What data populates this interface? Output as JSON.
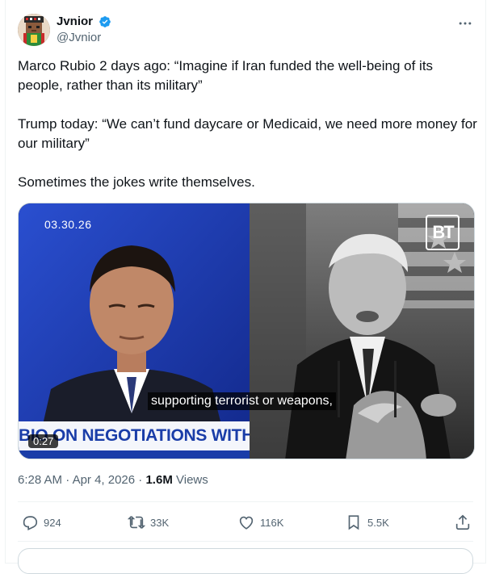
{
  "author": {
    "display_name": "Jvnior",
    "handle": "@Jvnior",
    "verified": true,
    "verified_color": "#1d9bf0"
  },
  "tweet": {
    "paragraphs": [
      "Marco Rubio 2 days ago: “Imagine if Iran funded the well-being of its people, rather than its military”",
      "Trump today: “We can’t fund daycare or Medicaid, we need more money for our military”",
      "Sometimes the jokes write themselves."
    ]
  },
  "video": {
    "date_overlay": "03.30.26",
    "caption": "supporting terrorist or weapons,",
    "lower_third": "BIO ON NEGOTIATIONS WITH IR",
    "duration": "0:27",
    "logo_text": "BT"
  },
  "meta": {
    "time": "6:28 AM",
    "separator": "·",
    "date": "Apr 4, 2026",
    "views_count": "1.6M",
    "views_label": "Views"
  },
  "actions": {
    "replies": "924",
    "reposts": "33K",
    "likes": "116K",
    "bookmarks": "5.5K"
  },
  "icons": {
    "reply": "reply-icon",
    "repost": "repost-icon",
    "like": "heart-icon",
    "bookmark": "bookmark-icon",
    "share": "share-icon",
    "more": "more-icon"
  },
  "colors": {
    "text_primary": "#0f1419",
    "text_secondary": "#536471",
    "border": "#eff3f4",
    "media_blue_left": "#1d3fa8",
    "lower_third_blue": "#1a3da8"
  }
}
